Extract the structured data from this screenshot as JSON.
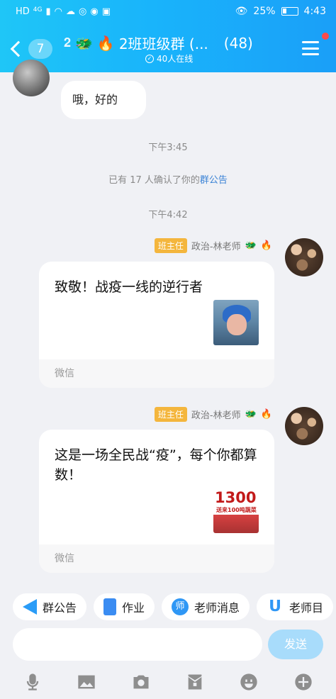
{
  "status_bar": {
    "left_icons": [
      "HD",
      "4G",
      "signal-icon",
      "wifi-icon",
      "cloud-icon",
      "app-icon",
      "weibo-icon",
      "app-icon"
    ],
    "battery": "25%",
    "time": "4:43"
  },
  "header": {
    "back_count": "7",
    "title": "2班班级群 (...",
    "member_count": "(48)",
    "online": "40人在线"
  },
  "messages": {
    "incoming_text": "哦，好的",
    "time1": "下午3:45",
    "notice_prefix": "已有 17 人确认了你的",
    "notice_link": "群公告",
    "time2": "下午4:42",
    "msg1": {
      "badge": "班主任",
      "sender": "政治-林老师",
      "text": "致敬！战疫一线的逆行者",
      "source": "微信"
    },
    "msg2": {
      "badge": "班主任",
      "sender": "政治-林老师",
      "text": "这是一场全民战“疫”，每个你都算数！",
      "source": "微信",
      "thumb_big": "1300",
      "thumb_small": "送来100吨蔬菜"
    }
  },
  "quick_actions": [
    {
      "label": "群公告",
      "icon": "megaphone-icon"
    },
    {
      "label": "作业",
      "icon": "document-icon"
    },
    {
      "label": "老师消息",
      "icon": "teacher-icon"
    },
    {
      "label": "老师目",
      "icon": "u-icon"
    }
  ],
  "input": {
    "placeholder": "",
    "send_label": "发送"
  },
  "toolbar_icons": [
    "microphone-icon",
    "image-icon",
    "camera-icon",
    "red-packet-icon",
    "emoji-icon",
    "plus-icon"
  ],
  "colors": {
    "header_start": "#1fc6f7",
    "header_end": "#1a9ff8",
    "badge": "#f4b63d",
    "link": "#3b83d6",
    "send": "#a8dcfb"
  }
}
